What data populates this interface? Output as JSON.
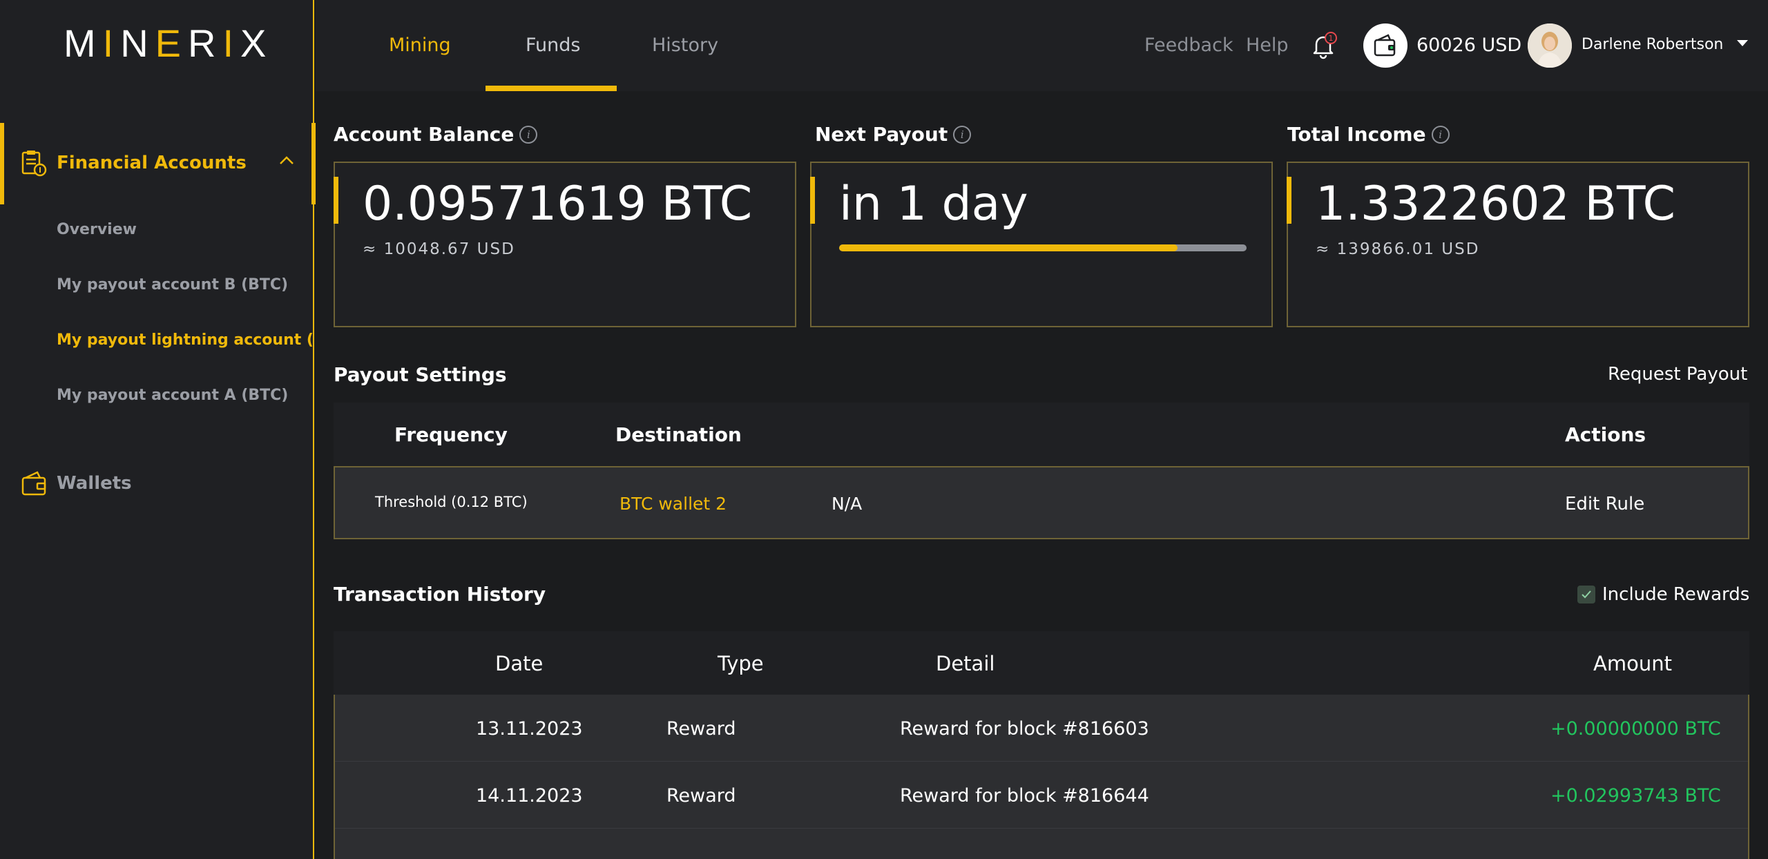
{
  "brand": {
    "name": "MINERIX"
  },
  "sidebar": {
    "groups": [
      {
        "label": "Financial Accounts",
        "expanded": true
      },
      {
        "label": "Wallets",
        "expanded": false
      }
    ],
    "sub_items": [
      {
        "label": "Overview",
        "active": false
      },
      {
        "label": "My payout account B (BTC)",
        "active": false
      },
      {
        "label": "My payout lightning account (B...",
        "active": true
      },
      {
        "label": "My payout account A (BTC)",
        "active": false
      }
    ]
  },
  "header": {
    "tabs": [
      {
        "label": "Mining",
        "state": "highlight"
      },
      {
        "label": "Funds",
        "state": "selected"
      },
      {
        "label": "History",
        "state": "default"
      }
    ],
    "links": {
      "feedback": "Feedback",
      "help": "Help"
    },
    "notification_count": "1",
    "balance": "60026 USD",
    "user_name": "Darlene Robertson"
  },
  "cards": {
    "account_balance": {
      "title": "Account Balance",
      "value": "0.09571619 BTC",
      "sub": "≈ 10048.67 USD"
    },
    "next_payout": {
      "title": "Next Payout",
      "value": "in 1 day",
      "progress": 0.83
    },
    "total_income": {
      "title": "Total Income",
      "value": "1.3322602 BTC",
      "sub": "≈ 139866.01 USD"
    }
  },
  "payout_settings": {
    "title": "Payout Settings",
    "action": "Request Payout",
    "columns": {
      "frequency": "Frequency",
      "destination": "Destination",
      "actions": "Actions"
    },
    "row": {
      "frequency": "Threshold (0.12 BTC)",
      "destination": "BTC wallet 2",
      "extra": "N/A",
      "action": "Edit Rule"
    }
  },
  "transaction_history": {
    "title": "Transaction History",
    "include_rewards": {
      "label": "Include Rewards",
      "checked": true
    },
    "columns": {
      "date": "Date",
      "type": "Type",
      "detail": "Detail",
      "amount": "Amount"
    },
    "rows": [
      {
        "date": "13.11.2023",
        "type": "Reward",
        "detail": "Reward for block #816603",
        "amount": "+0.00000000 BTC"
      },
      {
        "date": "14.11.2023",
        "type": "Reward",
        "detail": "Reward for block #816644",
        "amount": "+0.02993743 BTC"
      },
      {
        "date": "",
        "type": "",
        "detail": "",
        "amount": ""
      }
    ]
  },
  "colors": {
    "accent": "#f0b90b",
    "positive": "#22c55e",
    "background": "#1b1c1e"
  }
}
